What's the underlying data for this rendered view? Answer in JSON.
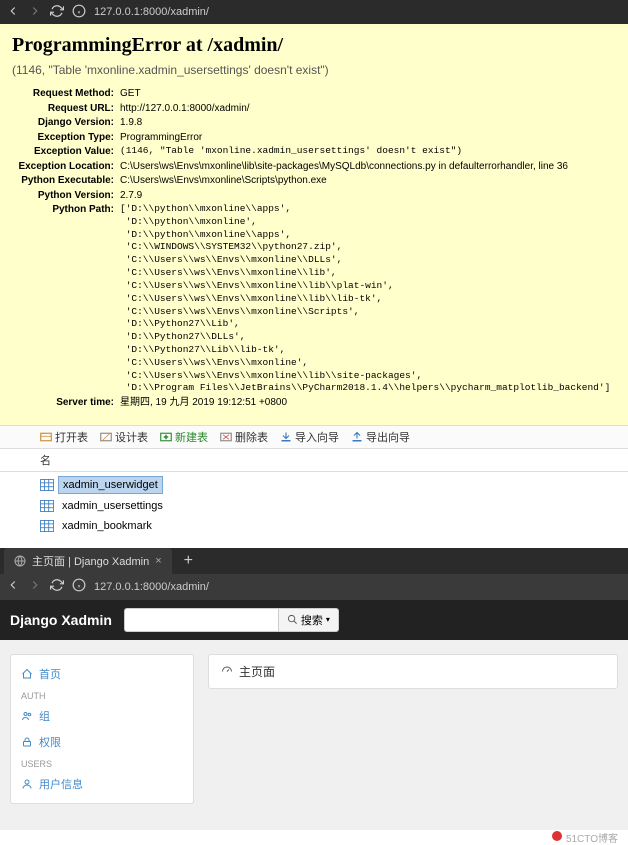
{
  "browser1": {
    "url_display": "127.0.0.1:8000/xadmin/"
  },
  "error": {
    "title": "ProgrammingError at /xadmin/",
    "subtitle": "(1146, \"Table 'mxonline.xadmin_usersettings' doesn't exist\")",
    "rows": {
      "request_method": {
        "label": "Request Method:",
        "value": "GET"
      },
      "request_url": {
        "label": "Request URL:",
        "value": "http://127.0.0.1:8000/xadmin/"
      },
      "django_version": {
        "label": "Django Version:",
        "value": "1.9.8"
      },
      "exception_type": {
        "label": "Exception Type:",
        "value": "ProgrammingError"
      },
      "exception_value": {
        "label": "Exception Value:",
        "value": "(1146, \"Table 'mxonline.xadmin_usersettings' doesn't exist\")"
      },
      "exception_location": {
        "label": "Exception Location:",
        "value": "C:\\Users\\ws\\Envs\\mxonline\\lib\\site-packages\\MySQLdb\\connections.py in defaulterrorhandler, line 36"
      },
      "python_executable": {
        "label": "Python Executable:",
        "value": "C:\\Users\\ws\\Envs\\mxonline\\Scripts\\python.exe"
      },
      "python_version": {
        "label": "Python Version:",
        "value": "2.7.9"
      },
      "python_path": {
        "label": "Python Path:",
        "value": "['D:\\\\python\\\\mxonline\\\\apps',\n 'D:\\\\python\\\\mxonline',\n 'D:\\\\python\\\\mxonline\\\\apps',\n 'C:\\\\WINDOWS\\\\SYSTEM32\\\\python27.zip',\n 'C:\\\\Users\\\\ws\\\\Envs\\\\mxonline\\\\DLLs',\n 'C:\\\\Users\\\\ws\\\\Envs\\\\mxonline\\\\lib',\n 'C:\\\\Users\\\\ws\\\\Envs\\\\mxonline\\\\lib\\\\plat-win',\n 'C:\\\\Users\\\\ws\\\\Envs\\\\mxonline\\\\lib\\\\lib-tk',\n 'C:\\\\Users\\\\ws\\\\Envs\\\\mxonline\\\\Scripts',\n 'D:\\\\Python27\\\\Lib',\n 'D:\\\\Python27\\\\DLLs',\n 'D:\\\\Python27\\\\Lib\\\\lib-tk',\n 'C:\\\\Users\\\\ws\\\\Envs\\\\mxonline',\n 'C:\\\\Users\\\\ws\\\\Envs\\\\mxonline\\\\lib\\\\site-packages',\n 'D:\\\\Program Files\\\\JetBrains\\\\PyCharm2018.1.4\\\\helpers\\\\pycharm_matplotlib_backend']"
      },
      "server_time": {
        "label": "Server time:",
        "value": "星期四, 19 九月 2019 19:12:51 +0800"
      }
    }
  },
  "dbtool": {
    "toolbar": {
      "open": "打开表",
      "design": "设计表",
      "new": "新建表",
      "delete": "删除表",
      "import": "导入向导",
      "export": "导出向导"
    },
    "header_col": "名",
    "tables": [
      {
        "name": "xadmin_userwidget",
        "selected": true
      },
      {
        "name": "xadmin_usersettings",
        "selected": false
      },
      {
        "name": "xadmin_bookmark",
        "selected": false
      }
    ]
  },
  "browser2": {
    "tab_title": "主页面 | Django Xadmin",
    "url_display": "127.0.0.1:8000/xadmin/"
  },
  "xadmin": {
    "brand": "Django Xadmin",
    "search_placeholder": "",
    "search_btn": "搜索",
    "sidebar": {
      "home": "首页",
      "group_auth": "AUTH",
      "item_group": "组",
      "item_perm": "权限",
      "group_users": "USERS",
      "item_userinfo": "用户信息"
    },
    "panel_title": "主页面"
  },
  "watermark": "51CTO博客"
}
